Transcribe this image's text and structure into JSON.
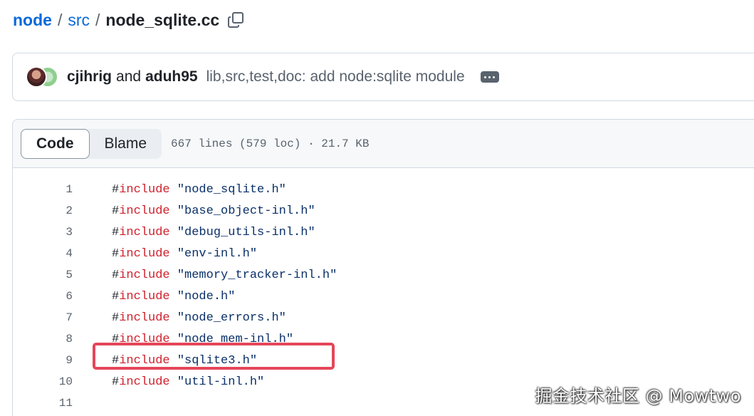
{
  "breadcrumb": {
    "repo": "node",
    "folder": "src",
    "file": "node_sqlite.cc",
    "separator": "/",
    "copy_icon": "copy-icon"
  },
  "commit": {
    "author1": "cjihrig",
    "and_text": "and",
    "author2": "aduh95",
    "message": "lib,src,test,doc: add node:sqlite module",
    "more_icon": "ellipsis-icon"
  },
  "file_header": {
    "tabs": [
      {
        "label": "Code",
        "active": true
      },
      {
        "label": "Blame",
        "active": false
      }
    ],
    "meta": "667 lines (579 loc) · 21.7 KB"
  },
  "code": {
    "directive": "#",
    "keyword": "include",
    "lines": [
      {
        "number": "1",
        "string": "\"node_sqlite.h\""
      },
      {
        "number": "2",
        "string": "\"base_object-inl.h\""
      },
      {
        "number": "3",
        "string": "\"debug_utils-inl.h\""
      },
      {
        "number": "4",
        "string": "\"env-inl.h\""
      },
      {
        "number": "5",
        "string": "\"memory_tracker-inl.h\""
      },
      {
        "number": "6",
        "string": "\"node.h\""
      },
      {
        "number": "7",
        "string": "\"node_errors.h\""
      },
      {
        "number": "8",
        "string": "\"node_mem-inl.h\""
      },
      {
        "number": "9",
        "string": "\"sqlite3.h\""
      },
      {
        "number": "10",
        "string": "\"util-inl.h\""
      },
      {
        "number": "11",
        "string": ""
      }
    ]
  },
  "watermark": "掘金技术社区 @ Mowtwo",
  "colors": {
    "link": "#0969da",
    "keyword": "#cf222e",
    "string": "#0a3069",
    "highlight": "#e5465a"
  }
}
